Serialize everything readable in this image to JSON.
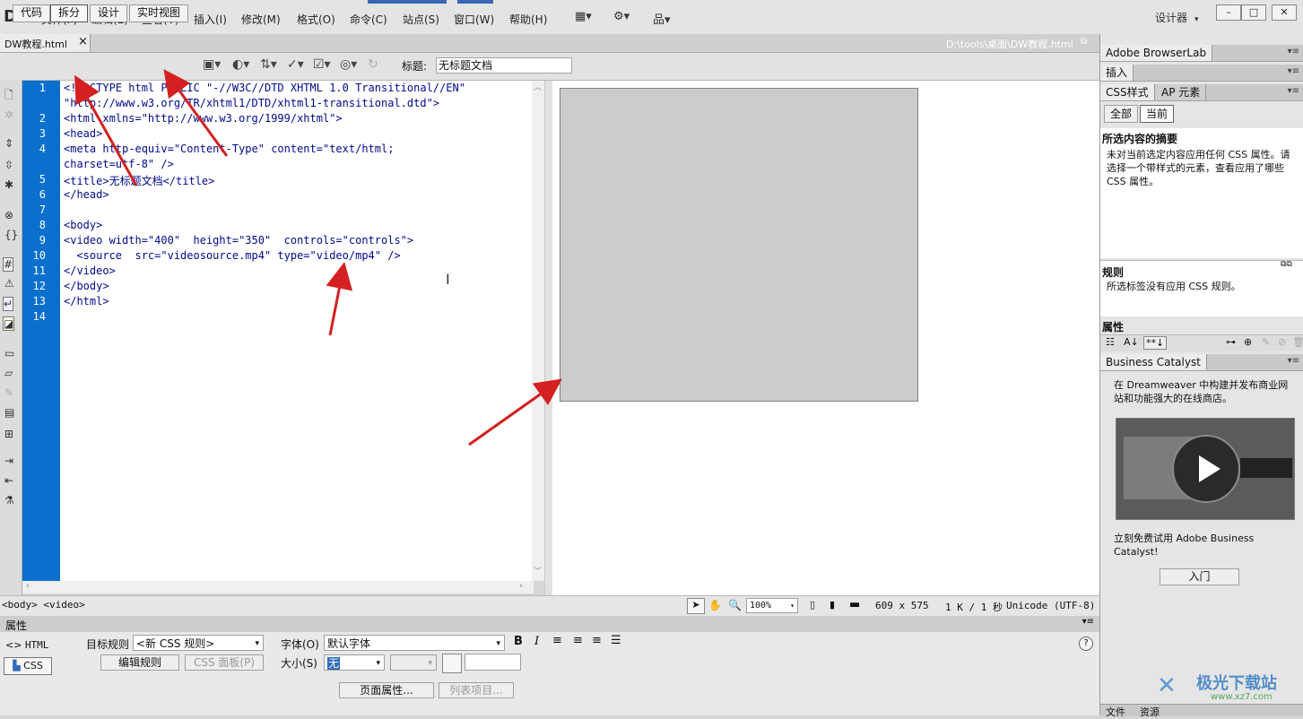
{
  "app": {
    "logo": "DW"
  },
  "menubar": {
    "items": [
      "文件(F)",
      "编辑(E)",
      "查看(V)",
      "插入(I)",
      "修改(M)",
      "格式(O)",
      "命令(C)",
      "站点(S)",
      "窗口(W)",
      "帮助(H)"
    ],
    "workspace": "设计器",
    "window_buttons": [
      "–",
      "□",
      "✕"
    ]
  },
  "document": {
    "tab_title": "DW教程.html",
    "close_glyph": "×",
    "file_path": "D:\\tools\\桌面\\DW教程.html"
  },
  "toolbar": {
    "view_buttons": [
      "代码",
      "拆分",
      "设计",
      "实时视图"
    ],
    "active_view": "拆分",
    "title_label": "标题:",
    "title_value": "无标题文档"
  },
  "code": {
    "lines": [
      {
        "num": "1",
        "text": "<!DOCTYPE html PUBLIC \"-//W3C//DTD XHTML 1.0 Transitional//EN\""
      },
      {
        "num": "",
        "text": "\"http://www.w3.org/TR/xhtml1/DTD/xhtml1-transitional.dtd\">"
      },
      {
        "num": "2",
        "text": "<html xmlns=\"http://www.w3.org/1999/xhtml\">"
      },
      {
        "num": "3",
        "text": "<head>"
      },
      {
        "num": "4",
        "text": "<meta http-equiv=\"Content-Type\" content=\"text/html;"
      },
      {
        "num": "",
        "text": "charset=utf-8\" />"
      },
      {
        "num": "5",
        "text": "<title>无标题文档</title>"
      },
      {
        "num": "6",
        "text": "</head>"
      },
      {
        "num": "7",
        "text": ""
      },
      {
        "num": "8",
        "text": "<body>"
      },
      {
        "num": "9",
        "text": "<video width=\"400\"  height=\"350\"  controls=\"controls\">"
      },
      {
        "num": "10",
        "text": "  <source  src=\"videosource.mp4\" type=\"video/mp4\" />"
      },
      {
        "num": "11",
        "text": "</video>"
      },
      {
        "num": "12",
        "text": "</body>"
      },
      {
        "num": "13",
        "text": "</html>"
      },
      {
        "num": "14",
        "text": ""
      }
    ]
  },
  "statusbar": {
    "tag_path": "<body> <video>",
    "zoom": "100%",
    "dimensions": "609 x 575",
    "download": "1 K / 1 秒",
    "encoding": "Unicode (UTF-8)"
  },
  "properties": {
    "header": "属性",
    "html_label": "HTML",
    "css_label": "CSS",
    "target_rule_label": "目标规则",
    "target_rule_value": "<新 CSS 规则>",
    "edit_rule_button": "编辑规则",
    "css_panel_button": "CSS 面板(P)",
    "font_label": "字体(O)",
    "font_value": "默认字体",
    "size_label": "大小(S)",
    "size_value": "无",
    "page_props_button": "页面属性...",
    "list_items_button": "列表项目...",
    "help_glyph": "?"
  },
  "right_panels": {
    "browserlab_title": "Adobe BrowserLab",
    "insert_tab": "插入",
    "css_tab": "CSS样式",
    "ap_tab": "AP 元素",
    "all_button": "全部",
    "current_button": "当前",
    "summary_title": "所选内容的摘要",
    "summary_text": "未对当前选定内容应用任何 CSS 属性。请选择一个带样式的元素，查看应用了哪些 CSS 属性。",
    "rules_title": "规则",
    "rules_text": "所选标签没有应用 CSS 规则。",
    "props_title": "属性",
    "bc_title": "Business Catalyst",
    "bc_text": "在 Dreamweaver 中构建并发布商业网站和功能强大的在线商店。",
    "bc_promo": "立刻免费试用 Adobe Business Catalyst!",
    "bc_button": "入门",
    "bottom_tabs": [
      "文件",
      "资源"
    ]
  },
  "watermark": {
    "text": "极光下载站",
    "url": "www.xz7.com"
  },
  "colors": {
    "gutter": "#0b6fce",
    "annotation_arrow": "#d42020",
    "code_text": "#000a8c"
  }
}
